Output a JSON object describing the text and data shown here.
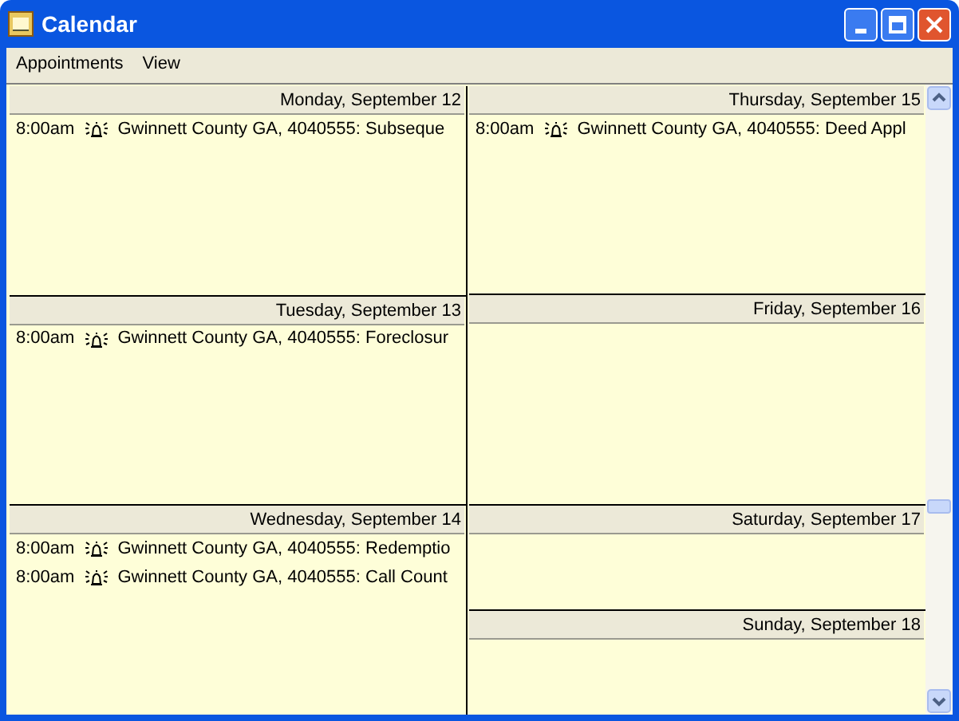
{
  "window": {
    "title": "Calendar"
  },
  "menu": [
    "Appointments",
    "View"
  ],
  "columns": [
    {
      "days": [
        {
          "title": "Monday, September 12",
          "kind": "weekday",
          "appointments": [
            {
              "time": "8:00am",
              "alarm": true,
              "text": "Gwinnett County GA, 4040555: Subseque"
            }
          ]
        },
        {
          "title": "Tuesday, September 13",
          "kind": "weekday",
          "appointments": [
            {
              "time": "8:00am",
              "alarm": true,
              "text": "Gwinnett County GA, 4040555: Foreclosur"
            }
          ]
        },
        {
          "title": "Wednesday, September 14",
          "kind": "weekday",
          "appointments": [
            {
              "time": "8:00am",
              "alarm": true,
              "text": "Gwinnett County GA, 4040555: Redemptio"
            },
            {
              "time": "8:00am",
              "alarm": true,
              "text": "Gwinnett County GA, 4040555: Call Count"
            }
          ]
        }
      ]
    },
    {
      "days": [
        {
          "title": "Thursday, September 15",
          "kind": "weekday",
          "appointments": [
            {
              "time": "8:00am",
              "alarm": true,
              "text": "Gwinnett County GA, 4040555: Deed Appl"
            }
          ]
        },
        {
          "title": "Friday, September 16",
          "kind": "weekday"
        },
        {
          "title": "Saturday, September 17",
          "kind": "weekend"
        },
        {
          "title": "Sunday, September 18",
          "kind": "weekend"
        }
      ]
    }
  ]
}
